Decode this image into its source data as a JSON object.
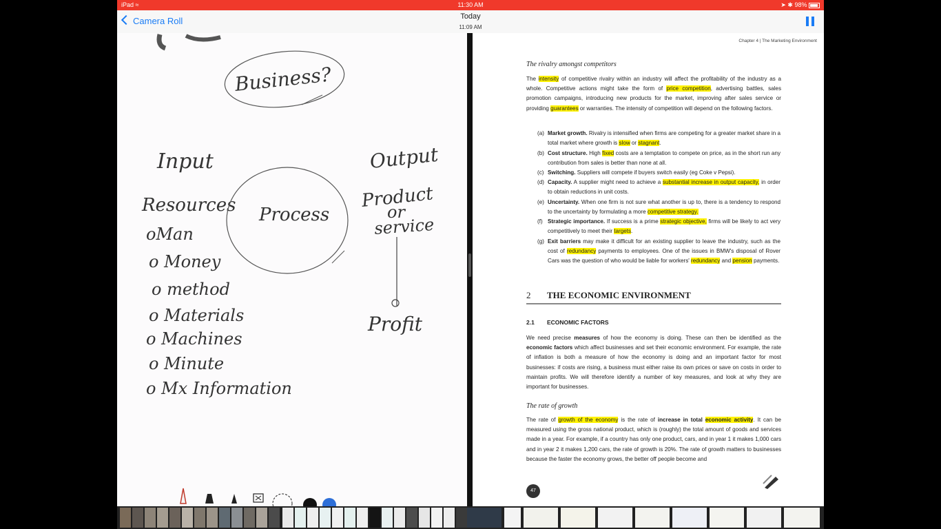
{
  "status_bar": {
    "device": "iPad",
    "time": "11:30 AM",
    "battery": "98%"
  },
  "nav": {
    "back_label": "Camera Roll",
    "title": "Today",
    "subtitle": "11:09 AM"
  },
  "notes": {
    "title_word": "Business?",
    "input": "Input",
    "output": "Output",
    "resources": "Resources",
    "process": "Process",
    "product_line1": "Product",
    "product_line2": "or",
    "product_line3": "service",
    "profit": "Profit",
    "items": [
      "oMan",
      "o Money",
      "o method",
      "o Materials",
      "o Machines",
      "o Minute",
      "o Mx Information"
    ]
  },
  "document": {
    "running_head": "Chapter 4 | The Marketing Environment",
    "rivalry_heading": "The rivalry amongst competitors",
    "intro": {
      "t1": "The ",
      "h1": "intensity",
      "t2": " of competitive rivalry within an industry will affect the profitability of the industry as a whole. Competitive actions might take the form of ",
      "h2": "price competition",
      "t3": ", advertising battles, sales promotion campaigns, introducing new products for the market, improving after sales service or providing ",
      "h3": "guarantees",
      "t4": " or warranties. The intensity of competition will depend on the following factors."
    },
    "factors": [
      {
        "label": "(a)",
        "bold": "Market growth.",
        "t1": " Rivalry is intensified when firms are competing for a greater market share in a total market where growth is ",
        "h1": "slow",
        "t2": " or ",
        "h2": "stagnant",
        "t3": "."
      },
      {
        "label": "(b)",
        "bold": "Cost structure.",
        "t1": " High ",
        "h1": "fixed",
        "t2": " costs are a temptation to compete on price, as in the short run any contribution from sales is better than none at all.",
        "h2": "",
        "t3": ""
      },
      {
        "label": "(c)",
        "bold": "Switching.",
        "t1": " Suppliers will compete if buyers switch easily (eg Coke v Pepsi).",
        "h1": "",
        "t2": "",
        "h2": "",
        "t3": ""
      },
      {
        "label": "(d)",
        "bold": "Capacity.",
        "t1": " A supplier might need to achieve a ",
        "h1": "substantial increase in output capacity,",
        "t2": " in order to obtain reductions in unit costs.",
        "h2": "",
        "t3": ""
      },
      {
        "label": "(e)",
        "bold": "Uncertainty.",
        "t1": " When one firm is not sure what another is up to, there is a tendency to respond to the uncertainty by formulating a more ",
        "h1": "competitive strategy.",
        "t2": "",
        "h2": "",
        "t3": ""
      },
      {
        "label": "(f)",
        "bold": "Strategic importance.",
        "t1": " If success is a prime ",
        "h1": "strategic objective,",
        "t2": " firms will be likely to act very competitively to meet their ",
        "h2": "targets",
        "t3": "."
      },
      {
        "label": "(g)",
        "bold": "Exit barriers",
        "t1": " may make it difficult for an existing supplier to leave the industry, such as the cost of ",
        "h1": "redundancy",
        "t2": " payments to employees. One of the issues in BMW's disposal of Rover Cars was the question of who would be liable for workers' ",
        "h2": "redundancy",
        "t3": " and ",
        "h3": "pension",
        "t4": " payments."
      }
    ],
    "section_number": "2",
    "section_title": "THE ECONOMIC ENVIRONMENT",
    "sub_number": "2.1",
    "sub_title": "ECONOMIC FACTORS",
    "econ_para": {
      "t1": "We need precise ",
      "b1": "measures",
      "t2": " of how the economy is doing. These can then be identified as the ",
      "b2": "economic factors",
      "t3": " which affect businesses and set their economic environment. For example, the rate of inflation is both a measure of how the economy is doing and an important factor for most businesses: if costs are rising, a business must either raise its own prices or save on costs in order to maintain profits. We will therefore identify a number of key measures, and look at why they are important for businesses."
    },
    "growth_heading": "The rate of growth",
    "growth_para": {
      "t1": "The rate of ",
      "h1": "growth of the economy",
      "t2": " is the rate of ",
      "b1": "increase in total",
      "t3": " ",
      "h2": "economic activity",
      "t4": ". It can be measured using the gross national product, which is (roughly) the total amount of goods and services made in a year. For example, if a country has only one product, cars, and in year 1 it makes 1,000 cars and in year 2 it makes 1,200 cars, the rate of growth is 20%. The rate of growth matters to businesses because the faster the economy grows, the better off people become and"
    },
    "page_number": "47"
  },
  "colors": {
    "status_bar": "#f0392b",
    "accent": "#1a7cf5",
    "highlight": "#fff200",
    "ink": "#333333"
  }
}
